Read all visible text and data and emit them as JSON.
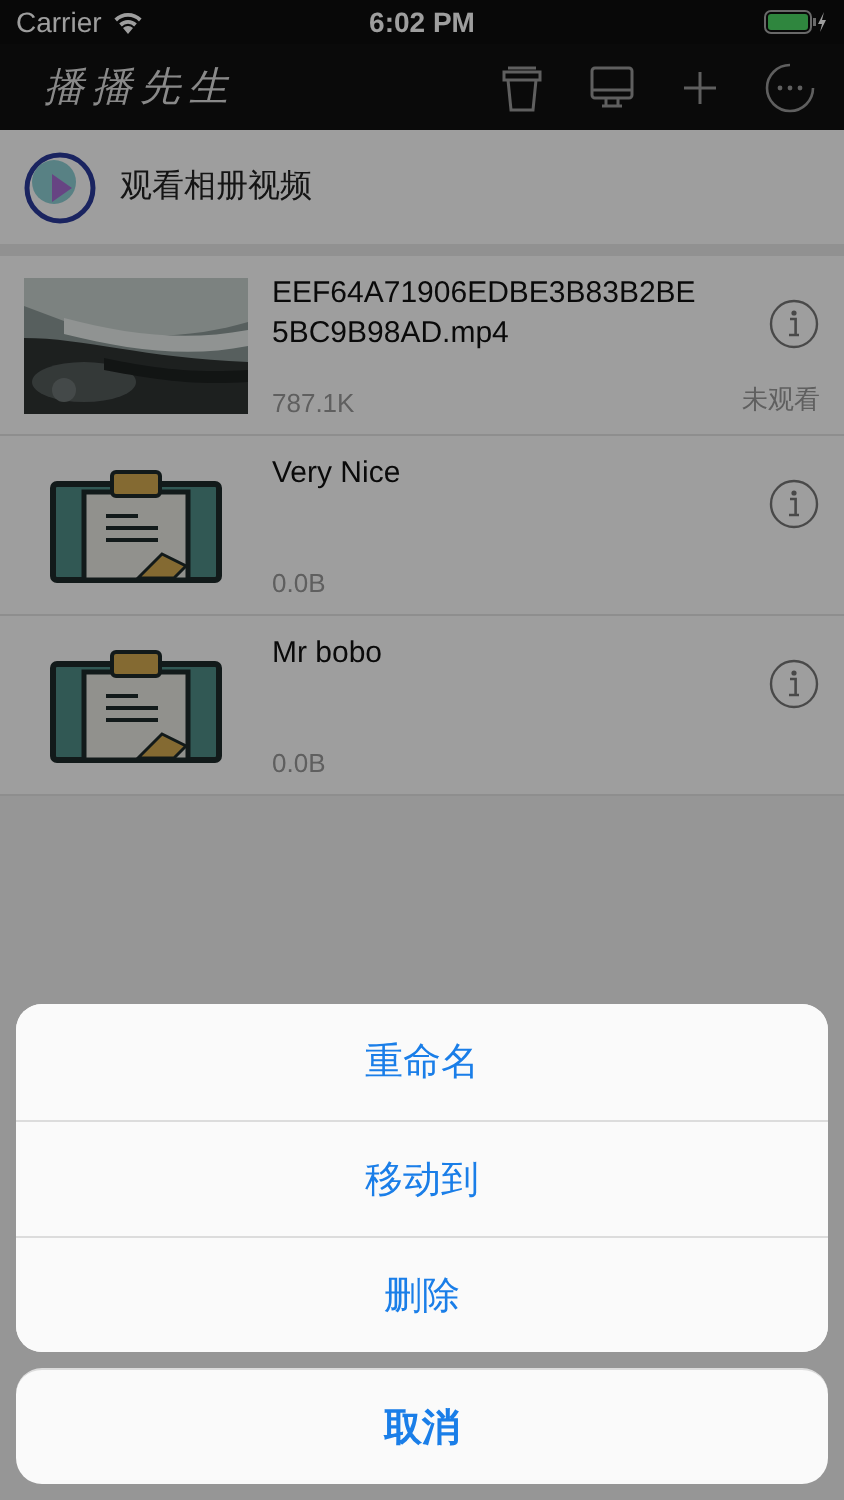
{
  "status_bar": {
    "carrier": "Carrier",
    "time": "6:02 PM"
  },
  "nav": {
    "title": "播播先生"
  },
  "album_row": {
    "label": "观看相册视频"
  },
  "files": [
    {
      "kind": "video",
      "name": "EEF64A71906EDBE3B83B2BE5BC9B98AD.mp4",
      "size": "787.1K",
      "status": "未观看"
    },
    {
      "kind": "document",
      "name": "Very Nice",
      "size": "0.0B"
    },
    {
      "kind": "document",
      "name": "Mr bobo",
      "size": "0.0B"
    }
  ],
  "action_sheet": {
    "actions": [
      "重命名",
      "移动到",
      "删除"
    ],
    "cancel": "取消"
  }
}
